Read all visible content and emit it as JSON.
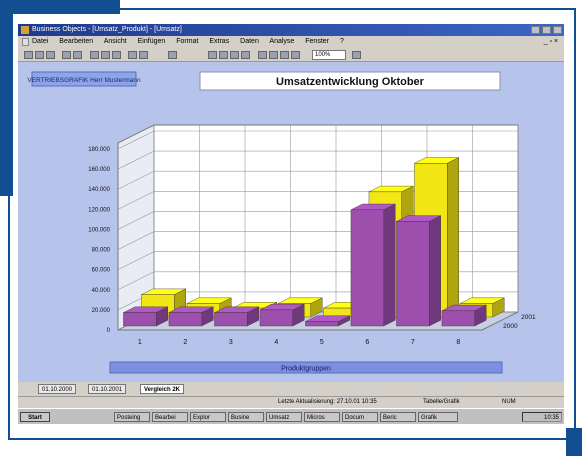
{
  "window": {
    "title": "Business Objects - [Umsatz_Produkt] - [Umsatz]",
    "menu": [
      "Datei",
      "Bearbeiten",
      "Ansicht",
      "Einfügen",
      "Format",
      "Extras",
      "Daten",
      "Analyse",
      "Fenster",
      "?"
    ],
    "menu_right": "_ ▫ ×",
    "zoom": "100%"
  },
  "report": {
    "user_label": "VERTRIEBSGRAFIK Herr Mustermann",
    "title": "Umsatzentwicklung Oktober",
    "footer_label": "Produktgruppen"
  },
  "chart_data": {
    "type": "bar",
    "style": "3d-grouped-depth",
    "categories": [
      "1",
      "2",
      "3",
      "4",
      "5",
      "6",
      "7",
      "8"
    ],
    "series": [
      {
        "name": "2000",
        "color": "#9d4fae",
        "values": [
          15000,
          15000,
          15000,
          18000,
          5000,
          130000,
          117000,
          17000
        ]
      },
      {
        "name": "2001",
        "color": "#f3e615",
        "values": [
          25000,
          15000,
          10000,
          15000,
          10000,
          140000,
          172000,
          15000
        ]
      }
    ],
    "y_ticks": [
      "0",
      "20.000",
      "40.000",
      "60.000",
      "80.000",
      "100.000",
      "120.000",
      "140.000",
      "160.000",
      "180.000"
    ],
    "ylim": [
      0,
      190000
    ],
    "grid": true
  },
  "status": {
    "sheet_tabs": [
      "01.10.2000",
      "01.10.2001",
      "Vergleich 2K"
    ],
    "active_tab": 2,
    "status_text": "Letzte Aktualisierung: 27.10.01 10:35",
    "status_mid": "Tabelle/Grafik",
    "status_right": "NUM"
  },
  "taskbar": {
    "start_label": "Start",
    "tasks": [
      "Posteing",
      "Bearbei",
      "Explor",
      "Busine",
      "Umsatz",
      "Micros",
      "Docum",
      "Beric",
      "Grafik"
    ],
    "clock": "10:35"
  },
  "colors": {
    "accent_blue": "#114f91",
    "canvas": "#b6c3ea",
    "footer_bar": "#7d8fe0"
  }
}
